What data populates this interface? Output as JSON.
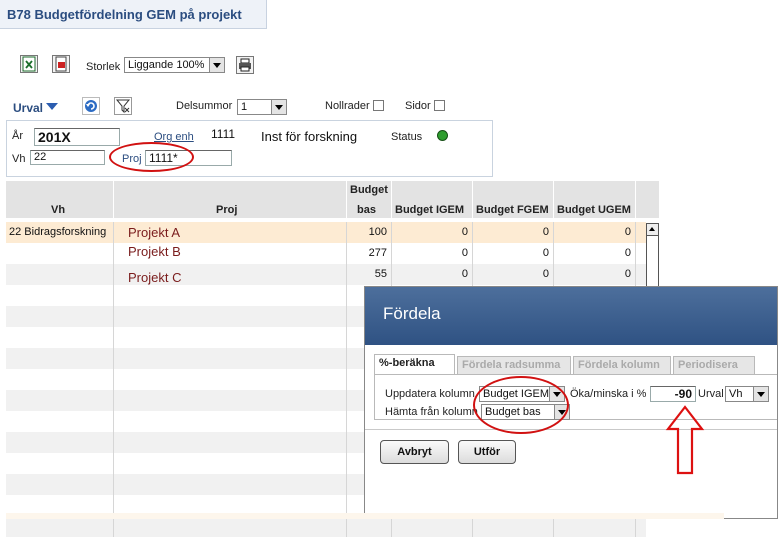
{
  "title": "B78 Budgetfördelning GEM på projekt",
  "toolbar": {
    "icons": [
      "excel-icon",
      "pdf-icon",
      "print-icon"
    ],
    "storlek_label": "Storlek",
    "storlek_value": "Liggande 100%"
  },
  "urval": {
    "label": "Urval",
    "delsummor_label": "Delsummor",
    "delsummor_value": "1",
    "nollrader_label": "Nollrader",
    "sidor_label": "Sidor"
  },
  "filters": {
    "ar_label": "År",
    "ar_value": "201X",
    "orgenh_label": "Org enh",
    "orgenh_value": "1111",
    "orgenh_name": "Inst för forskning",
    "status_label": "Status",
    "status_color": "#2e9d2e",
    "vh_label": "Vh",
    "vh_value": "22",
    "proj_label": "Proj",
    "proj_value": "1111*"
  },
  "table": {
    "headers": {
      "vh": "Vh",
      "proj": "Proj",
      "budget_bas_1": "Budget",
      "budget_bas_2": "bas",
      "igem": "Budget IGEM",
      "fgem": "Budget FGEM",
      "ugem": "Budget UGEM"
    },
    "rows": [
      {
        "vh": "22 Bidragsforskning",
        "proj": "Projekt A",
        "bas": "100",
        "igem": "0",
        "fgem": "0",
        "ugem": "0"
      },
      {
        "vh": "",
        "proj": "Projekt B",
        "bas": "277",
        "igem": "0",
        "fgem": "0",
        "ugem": "0"
      },
      {
        "vh": "",
        "proj": "Projekt C",
        "bas": "55",
        "igem": "0",
        "fgem": "0",
        "ugem": "0"
      }
    ]
  },
  "dialog": {
    "title": "Fördela",
    "tabs": [
      "%-beräkna",
      "Fördela radsumma",
      "Fördela kolumn",
      "Periodisera"
    ],
    "uppdatera_label": "Uppdatera kolumn",
    "uppdatera_value": "Budget IGEM",
    "oka_label": "Öka/minska i %",
    "oka_value": "-90",
    "urval_label": "Urval",
    "urval_value": "Vh",
    "hamta_label": "Hämta från kolumn",
    "hamta_value": "Budget bas",
    "cancel_label": "Avbryt",
    "execute_label": "Utför"
  },
  "annotation_color": "#d11111"
}
